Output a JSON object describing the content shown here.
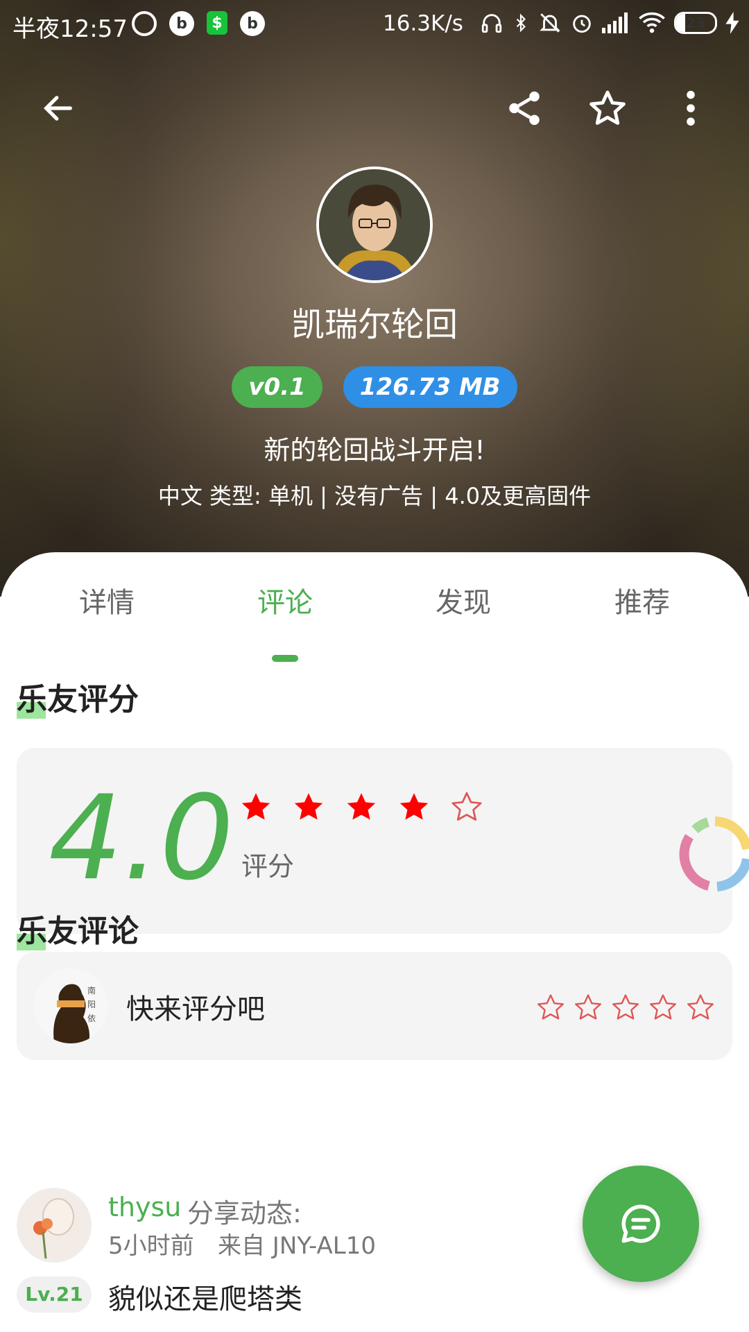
{
  "status_bar": {
    "time": "半夜12:57",
    "net_speed": "16.3K/s",
    "battery": "23",
    "battery_level_pct": 23
  },
  "toolbar": {
    "back_icon": "arrow-left-icon",
    "share_icon": "share-icon",
    "favorite_icon": "star-outline-icon",
    "more_icon": "more-vertical-icon"
  },
  "app": {
    "name": "凯瑞尔轮回",
    "version_badge": "v0.1",
    "size_badge": "126.73 MB",
    "slogan": "新的轮回战斗开启!",
    "meta": "中文 类型: 单机 | 没有广告 | 4.0及更高固件"
  },
  "tabs": [
    {
      "label": "详情"
    },
    {
      "label": "评论",
      "active": true
    },
    {
      "label": "发现"
    },
    {
      "label": "推荐"
    }
  ],
  "rating_section": {
    "title": "乐友评分",
    "score": "4.0",
    "stars": 4,
    "max_stars": 5,
    "label": "评分"
  },
  "rate_prompt": {
    "text": "快来评分吧",
    "max_stars": 5
  },
  "comments_section": {
    "title": "乐友评论",
    "comments": [
      {
        "user": "thysu",
        "action": "分享动态:",
        "time": "5小时前",
        "from": "来自 JNY-AL10",
        "level": "Lv.21",
        "text": "貌似还是爬塔类"
      }
    ]
  },
  "colors": {
    "accent": "#4caf50",
    "size_badge": "#2f8fe6",
    "star_filled": "#ff0000"
  },
  "fab": {
    "icon": "chat-message-icon"
  }
}
